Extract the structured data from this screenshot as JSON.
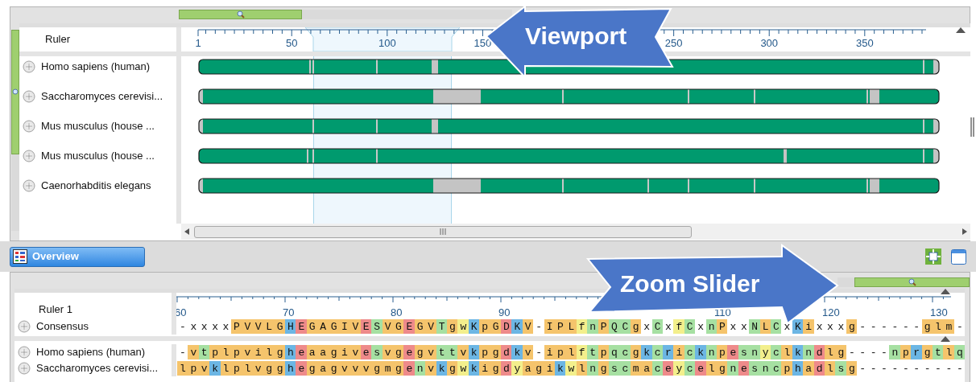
{
  "overview": {
    "zoom_slider": {
      "level": 0.37
    },
    "vertical_zoom_slider": {
      "level": 0.62
    },
    "ruler": {
      "label": "Ruler",
      "ticks": [
        "1",
        "50",
        "100",
        "150",
        "250",
        "300",
        "350"
      ]
    },
    "sequences": [
      {
        "name": "Homo sapiens (human)"
      },
      {
        "name": "Saccharomyces cerevisi..."
      },
      {
        "name": "Mus musculus (house ..."
      },
      {
        "name": "Mus musculus (house ..."
      },
      {
        "name": "Caenorhabditis elegans"
      }
    ]
  },
  "tab": {
    "label": "Overview",
    "selected": true
  },
  "detail": {
    "zoom_slider": {
      "level": 0.87
    },
    "ruler": {
      "label": "Ruler 1",
      "ticks": [
        "60",
        "70",
        "80",
        "90",
        "110",
        "120",
        "130"
      ]
    },
    "consensus": {
      "name": "Consensus",
      "residues": "-xxxxPVVLGHEGAGIVESVGEGVTgwKpGDKV-IPLfnPQCgxCxfCxnPxxNLCxKixxxg------glm-"
    },
    "sequences": [
      {
        "name": "Homo sapiens (human)",
        "residues": "-vtplpvilgheaagivesvgegvttvkpgdkv-iplftpqcgkcricknpesnyclkndlg----nprgtlq"
      },
      {
        "name": "Saccharomyces cerevisi...",
        "residues": "lpvklplvgghegagvvvgmgenvkgwkigdyagikwlngscmaceycelgnesncphadlsg----------"
      }
    ]
  },
  "callouts": [
    {
      "label": "Viewport",
      "kind": "left"
    },
    {
      "label": "Zoom Slider",
      "kind": "right"
    }
  ]
}
